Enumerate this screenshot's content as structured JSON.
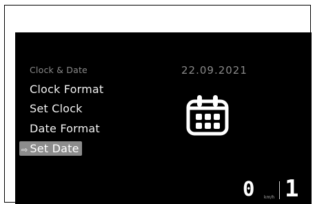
{
  "menu": {
    "title": "Clock & Date",
    "items": [
      {
        "label": "Clock Format"
      },
      {
        "label": "Set Clock"
      },
      {
        "label": "Date Format"
      },
      {
        "label": "Set Date",
        "selected": true
      }
    ],
    "selected_marker": "⇨"
  },
  "date_display": "22.09.2021",
  "icon": "calendar-icon",
  "speed": {
    "value": "0",
    "unit": "km/h"
  },
  "gear": "1",
  "colors": {
    "background": "#000000",
    "text": "#f2f2f2",
    "muted_text": "#8a8a8a",
    "selection": "#8c8c8c"
  }
}
